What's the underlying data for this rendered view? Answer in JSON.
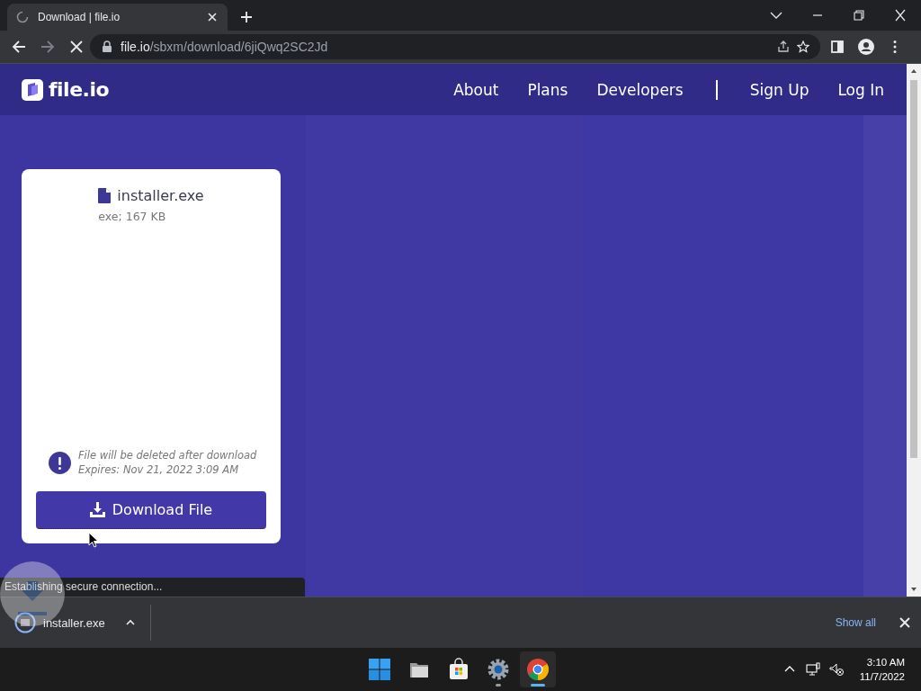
{
  "browser": {
    "tab": {
      "title": "Download | file.io",
      "loading": true
    },
    "address": {
      "host": "file.io",
      "path": "/sbxm/download/6jiQwq2SC2Jd"
    }
  },
  "site": {
    "logo": "file.io",
    "nav": [
      {
        "label": "About"
      },
      {
        "label": "Plans"
      },
      {
        "label": "Developers"
      }
    ],
    "auth": [
      {
        "label": "Sign Up"
      },
      {
        "label": "Log In"
      }
    ]
  },
  "file": {
    "name": "installer.exe",
    "meta": "exe; 167 KB",
    "notice": "File will be deleted after download",
    "expires": "Expires: Nov 21, 2022 3:09 AM",
    "button": "Download File"
  },
  "status_bubble": "Establishing secure connection...",
  "downloads": {
    "items": [
      {
        "name": "installer.exe"
      }
    ],
    "show_all": "Show all"
  },
  "taskbar": {
    "apps": [
      {
        "kind": "start",
        "running": false,
        "active": false
      },
      {
        "kind": "files",
        "running": false,
        "active": false
      },
      {
        "kind": "store",
        "running": false,
        "active": false
      },
      {
        "kind": "settings",
        "running": true,
        "active": false
      },
      {
        "kind": "browser",
        "running": true,
        "active": true
      }
    ],
    "clock": {
      "time": "3:10 AM",
      "date": "11/7/2022"
    }
  }
}
